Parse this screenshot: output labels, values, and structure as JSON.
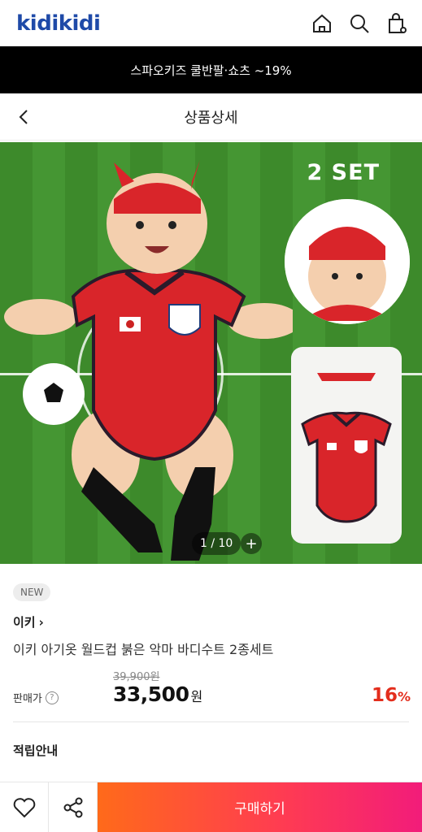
{
  "header": {
    "logo_text": "kidikidi",
    "icons": [
      "home-icon",
      "search-icon",
      "cart-icon"
    ]
  },
  "promo_banner": {
    "text": "스파오키즈 쿨반팔·쇼츠 ~19%"
  },
  "title_bar": {
    "title": "상품상세",
    "back_icon": "chevron-left-icon"
  },
  "product_image": {
    "set_label": "2 SET",
    "counter": "1 / 10",
    "plus_label": "+"
  },
  "product": {
    "badge": "NEW",
    "brand": "이키",
    "brand_arrow": "›",
    "name": "이키 아기옷 월드컵 붉은 악마 바디수트 2종세트",
    "original_price": "39,900원",
    "price_label": "판매가",
    "help_glyph": "?",
    "sale_price": "33,500",
    "price_unit": "원",
    "discount_value": "16",
    "discount_unit": "%"
  },
  "sections": {
    "reward_title": "적립안내"
  },
  "bottom_bar": {
    "buy_label": "구매하기",
    "icons": [
      "heart-icon",
      "share-icon"
    ]
  },
  "colors": {
    "brand_blue": "#1f4aa8",
    "discount_red": "#e32d1c",
    "buy_gradient_start": "#ff6a1a",
    "buy_gradient_end": "#f21c7a"
  }
}
